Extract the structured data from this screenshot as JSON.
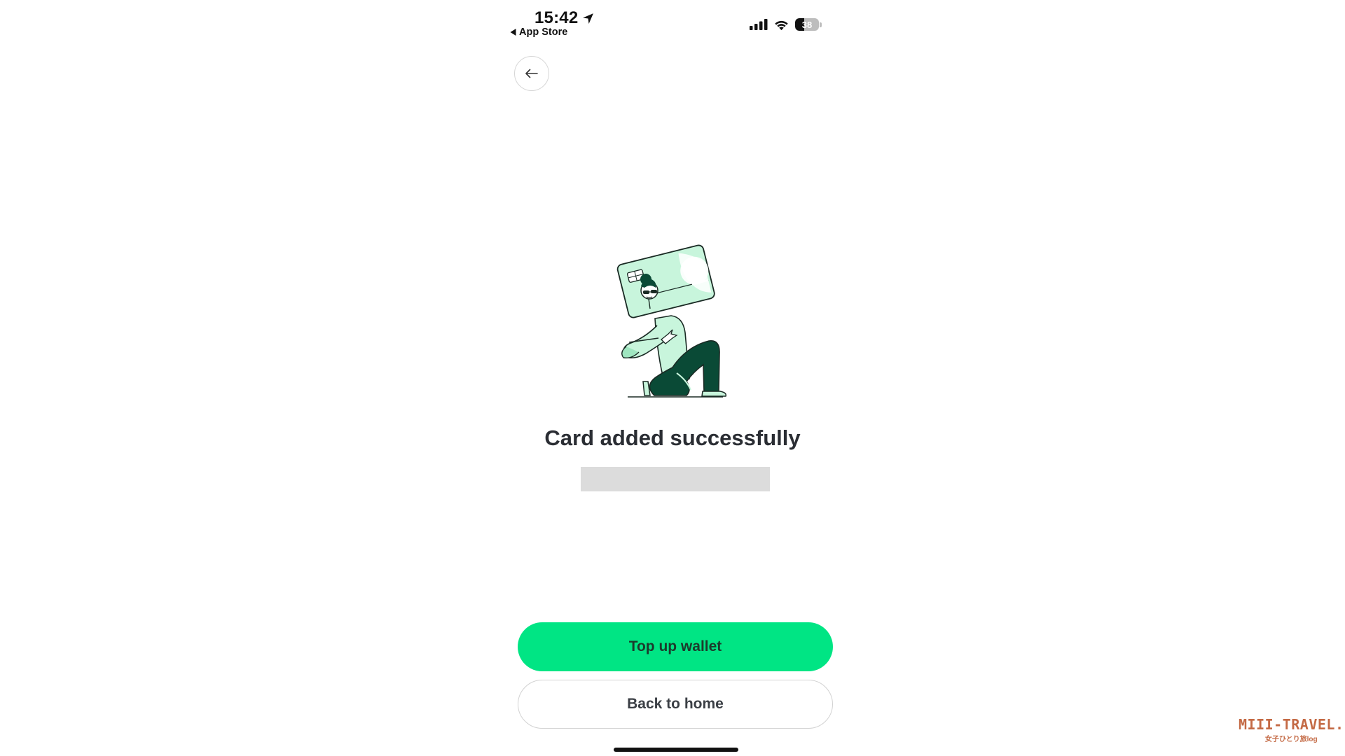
{
  "status_bar": {
    "time": "15:42",
    "back_app": "App Store",
    "battery_level": "38",
    "battery_fraction": 0.38
  },
  "nav": {
    "back_icon": "arrow-left-icon"
  },
  "main": {
    "title": "Card added successfully"
  },
  "actions": {
    "primary_label": "Top up wallet",
    "secondary_label": "Back to home"
  },
  "watermark": {
    "brand": "MIII-TRAVEL.",
    "tagline": "女子ひとり旅log"
  },
  "colors": {
    "accent_green": "#00e584",
    "dark_green": "#0a4a36",
    "card_green": "#c8f5dc",
    "title_text": "#2a2d33",
    "watermark": "#c46a45"
  }
}
